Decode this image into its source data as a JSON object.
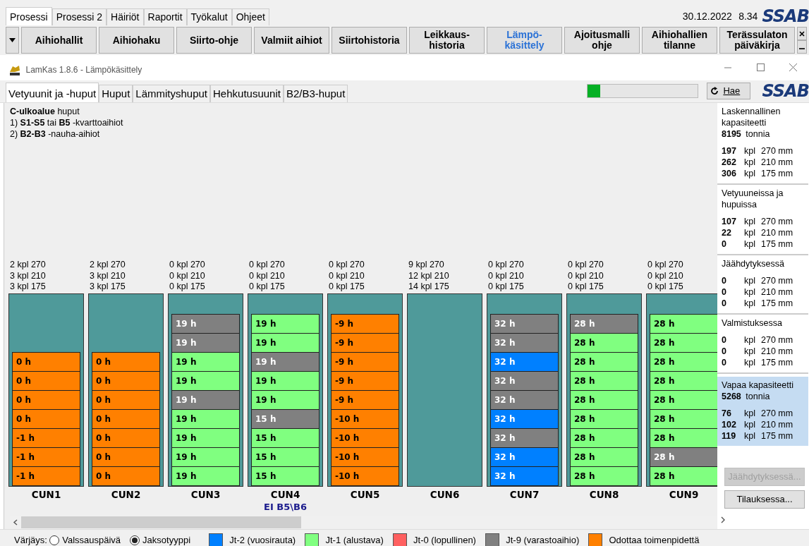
{
  "menu_tabs": [
    {
      "label": "Prosessi",
      "selected": true
    },
    {
      "label": "Prosessi 2",
      "selected": false
    },
    {
      "label": "Häiriöt",
      "selected": false
    },
    {
      "label": "Raportit",
      "selected": false
    },
    {
      "label": "Työkalut",
      "selected": false
    },
    {
      "label": "Ohjeet",
      "selected": false
    }
  ],
  "date": "30.12.2022",
  "time": "8.34",
  "logo": "SSAB",
  "toolbar": [
    {
      "label": "Aihiohallit",
      "selected": false
    },
    {
      "label": "Aihiohaku",
      "selected": false
    },
    {
      "label": "Siirto-ohje",
      "selected": false
    },
    {
      "label": "Valmiit aihiot",
      "selected": false
    },
    {
      "label": "Siirtohistoria",
      "selected": false
    },
    {
      "label": "Leikkaus-historia",
      "selected": false
    },
    {
      "label": "Lämpö-käsittely",
      "selected": true
    },
    {
      "label": "Ajoitusmalli ohje",
      "selected": false
    },
    {
      "label": "Aihiohallien tilanne",
      "selected": false
    },
    {
      "label": "Terässulaton päiväkirja",
      "selected": false
    }
  ],
  "window": {
    "title": "LamKas 1.8.6 - Lämpökäsittely"
  },
  "view_tabs": [
    {
      "label": "Vetyuunit ja -huput",
      "selected": true
    },
    {
      "label": "Huput",
      "selected": false
    },
    {
      "label": "Lämmityshuput",
      "selected": false
    },
    {
      "label": "Hehkutusuunit",
      "selected": false
    },
    {
      "label": "B2/B3-huput",
      "selected": false
    }
  ],
  "progress": {
    "level": 0.11
  },
  "refresh_button": "Hae",
  "window_logo": "SSAB",
  "info_lines": [
    "**C-ulkoalue** huput",
    "1) **S1-S5** tai **B5** -kvarttoaihiot",
    "2) **B2-B3** -nauha-aihiot"
  ],
  "furnaces": [
    {
      "name": "CUN1",
      "counts": [
        "2 kpl 270",
        "3 kpl 210",
        "3 kpl 175"
      ],
      "cells": [
        {
          "label": "0 h",
          "color": "#ff8000"
        },
        {
          "label": "0 h",
          "color": "#ff8000"
        },
        {
          "label": "0 h",
          "color": "#ff8000"
        },
        {
          "label": "0 h",
          "color": "#ff8000"
        },
        {
          "label": "-1 h",
          "color": "#ff8000"
        },
        {
          "label": "-1 h",
          "color": "#ff8000"
        },
        {
          "label": "-1 h",
          "color": "#ff8000"
        }
      ]
    },
    {
      "name": "CUN2",
      "counts": [
        "2 kpl 270",
        "3 kpl 210",
        "3 kpl 175"
      ],
      "cells": [
        {
          "label": "0 h",
          "color": "#ff8000"
        },
        {
          "label": "0 h",
          "color": "#ff8000"
        },
        {
          "label": "0 h",
          "color": "#ff8000"
        },
        {
          "label": "0 h",
          "color": "#ff8000"
        },
        {
          "label": "0 h",
          "color": "#ff8000"
        },
        {
          "label": "0 h",
          "color": "#ff8000"
        },
        {
          "label": "0 h",
          "color": "#ff8000"
        }
      ]
    },
    {
      "name": "CUN3",
      "counts": [
        "0 kpl 270",
        "0 kpl 210",
        "0 kpl 175"
      ],
      "cells": [
        {
          "label": "19 h",
          "color": "#808080"
        },
        {
          "label": "19 h",
          "color": "#808080"
        },
        {
          "label": "19 h",
          "color": "#80ff80"
        },
        {
          "label": "19 h",
          "color": "#80ff80"
        },
        {
          "label": "19 h",
          "color": "#808080"
        },
        {
          "label": "19 h",
          "color": "#80ff80"
        },
        {
          "label": "19 h",
          "color": "#80ff80"
        },
        {
          "label": "19 h",
          "color": "#80ff80"
        },
        {
          "label": "19 h",
          "color": "#80ff80"
        }
      ]
    },
    {
      "name": "CUN4",
      "counts": [
        "0 kpl 270",
        "0 kpl 210",
        "0 kpl 175"
      ],
      "note": "EI B5\\B6",
      "cells": [
        {
          "label": "19 h",
          "color": "#80ff80"
        },
        {
          "label": "19 h",
          "color": "#80ff80"
        },
        {
          "label": "19 h",
          "color": "#808080"
        },
        {
          "label": "19 h",
          "color": "#80ff80"
        },
        {
          "label": "19 h",
          "color": "#80ff80"
        },
        {
          "label": "15 h",
          "color": "#808080"
        },
        {
          "label": "15 h",
          "color": "#80ff80"
        },
        {
          "label": "15 h",
          "color": "#80ff80"
        },
        {
          "label": "15 h",
          "color": "#80ff80"
        }
      ]
    },
    {
      "name": "CUN5",
      "counts": [
        "0 kpl 270",
        "0 kpl 210",
        "0 kpl 175"
      ],
      "cells": [
        {
          "label": "-9 h",
          "color": "#ff8000"
        },
        {
          "label": "-9 h",
          "color": "#ff8000"
        },
        {
          "label": "-9 h",
          "color": "#ff8000"
        },
        {
          "label": "-9 h",
          "color": "#ff8000"
        },
        {
          "label": "-9 h",
          "color": "#ff8000"
        },
        {
          "label": "-10 h",
          "color": "#ff8000"
        },
        {
          "label": "-10 h",
          "color": "#ff8000"
        },
        {
          "label": "-10 h",
          "color": "#ff8000"
        },
        {
          "label": "-10 h",
          "color": "#ff8000"
        }
      ]
    },
    {
      "name": "CUN6",
      "counts": [
        "9 kpl 270",
        "12 kpl 210",
        "14 kpl 175"
      ]
    },
    {
      "name": "CUN7",
      "counts": [
        "0 kpl 270",
        "0 kpl 210",
        "0 kpl 175"
      ],
      "cells": [
        {
          "label": "32 h",
          "color": "#808080"
        },
        {
          "label": "32 h",
          "color": "#808080"
        },
        {
          "label": "32 h",
          "color": "#0080ff"
        },
        {
          "label": "32 h",
          "color": "#808080"
        },
        {
          "label": "32 h",
          "color": "#808080"
        },
        {
          "label": "32 h",
          "color": "#0080ff"
        },
        {
          "label": "32 h",
          "color": "#808080"
        },
        {
          "label": "32 h",
          "color": "#0080ff"
        },
        {
          "label": "32 h",
          "color": "#0080ff"
        }
      ]
    },
    {
      "name": "CUN8",
      "counts": [
        "0 kpl 270",
        "0 kpl 210",
        "0 kpl 175"
      ],
      "cells": [
        {
          "label": "28 h",
          "color": "#808080"
        },
        {
          "label": "28 h",
          "color": "#80ff80"
        },
        {
          "label": "28 h",
          "color": "#80ff80"
        },
        {
          "label": "28 h",
          "color": "#80ff80"
        },
        {
          "label": "28 h",
          "color": "#80ff80"
        },
        {
          "label": "28 h",
          "color": "#80ff80"
        },
        {
          "label": "28 h",
          "color": "#80ff80"
        },
        {
          "label": "28 h",
          "color": "#80ff80"
        },
        {
          "label": "28 h",
          "color": "#80ff80"
        }
      ]
    },
    {
      "name": "CUN9",
      "counts": [
        "0 kpl 270",
        "0 kpl 210",
        "0 kpl 175"
      ],
      "cells": [
        {
          "label": "28 h",
          "color": "#80ff80"
        },
        {
          "label": "28 h",
          "color": "#80ff80"
        },
        {
          "label": "28 h",
          "color": "#80ff80"
        },
        {
          "label": "28 h",
          "color": "#80ff80"
        },
        {
          "label": "28 h",
          "color": "#80ff80"
        },
        {
          "label": "28 h",
          "color": "#80ff80"
        },
        {
          "label": "28 h",
          "color": "#80ff80"
        },
        {
          "label": "28 h",
          "color": "#808080"
        },
        {
          "label": "28 h",
          "color": "#80ff80"
        }
      ]
    }
  ],
  "summary": {
    "sections": [
      {
        "title": "Laskennallinen kapasiteetti",
        "total": {
          "value": "8195",
          "unit": "tonnia"
        },
        "highlighted": false,
        "rows": [
          {
            "count": "197",
            "unit": "kpl",
            "size": "270 mm"
          },
          {
            "count": "262",
            "unit": "kpl",
            "size": "210 mm"
          },
          {
            "count": "306",
            "unit": "kpl",
            "size": "175 mm"
          }
        ]
      },
      {
        "title": "Vetyuuneissa ja hupuissa",
        "highlighted": false,
        "rows": [
          {
            "count": "107",
            "unit": "kpl",
            "size": "270 mm"
          },
          {
            "count": "22",
            "unit": "kpl",
            "size": "210 mm"
          },
          {
            "count": "0",
            "unit": "kpl",
            "size": "175 mm"
          }
        ]
      },
      {
        "title": "Jäähdytyksessä",
        "highlighted": false,
        "rows": [
          {
            "count": "0",
            "unit": "kpl",
            "size": "270 mm"
          },
          {
            "count": "0",
            "unit": "kpl",
            "size": "210 mm"
          },
          {
            "count": "0",
            "unit": "kpl",
            "size": "175 mm"
          }
        ]
      },
      {
        "title": "Valmistuksessa",
        "highlighted": false,
        "rows": [
          {
            "count": "0",
            "unit": "kpl",
            "size": "270 mm"
          },
          {
            "count": "0",
            "unit": "kpl",
            "size": "210 mm"
          },
          {
            "count": "0",
            "unit": "kpl",
            "size": "175 mm"
          }
        ]
      },
      {
        "title": "Vapaa kapasiteetti",
        "total": {
          "value": "5268",
          "unit": "tonnia"
        },
        "highlighted": true,
        "rows": [
          {
            "count": "76",
            "unit": "kpl",
            "size": "270 mm"
          },
          {
            "count": "102",
            "unit": "kpl",
            "size": "210 mm"
          },
          {
            "count": "119",
            "unit": "kpl",
            "size": "175 mm"
          }
        ]
      }
    ],
    "buttons": [
      {
        "label": "Jäähdytyksessä...",
        "disabled": true
      },
      {
        "label": "Tilauksessa...",
        "disabled": false
      }
    ]
  },
  "coloring": {
    "label": "Värjäys:",
    "options": [
      {
        "label": "Valssauspäivä",
        "selected": false
      },
      {
        "label": "Jaksotyyppi",
        "selected": true
      }
    ]
  },
  "legend": [
    {
      "label": "Jt-2 (vuosirauta)",
      "color": "#0080ff"
    },
    {
      "label": "Jt-1 (alustava)",
      "color": "#80ff80"
    },
    {
      "label": "Jt-0 (lopullinen)",
      "color": "#ff6060"
    },
    {
      "label": "Jt-9 (varastoaihio)",
      "color": "#808080"
    },
    {
      "label": "Odottaa toimenpidettä",
      "color": "#ff8000"
    }
  ]
}
